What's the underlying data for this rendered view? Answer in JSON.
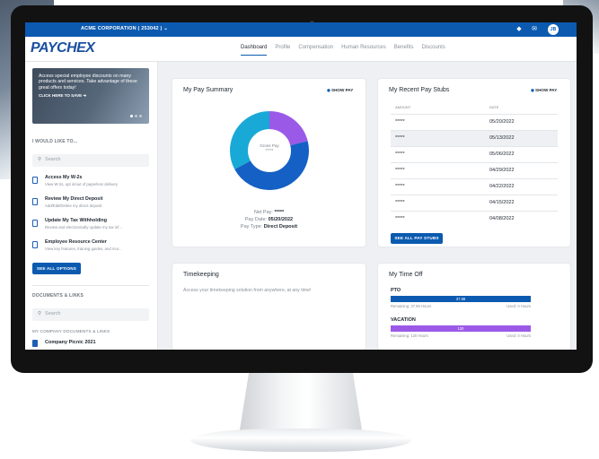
{
  "topbar": {
    "company": "ACME CORPORATION ( 253042 ) ⌄",
    "avatar_initials": "JB",
    "icons": [
      "pin-icon",
      "mail-icon"
    ]
  },
  "nav": {
    "logo": "PAYCHEX",
    "tabs": [
      {
        "label": "Dashboard",
        "active": true
      },
      {
        "label": "Profile"
      },
      {
        "label": "Compensation"
      },
      {
        "label": "Human Resources"
      },
      {
        "label": "Benefits"
      },
      {
        "label": "Discounts"
      }
    ]
  },
  "sidebar": {
    "banner": {
      "text": "Access special employee discounts on many products and services. Take advantage of these great offers today!",
      "cta": "CLICK HERE TO SAVE ➔"
    },
    "would_like_heading": "I WOULD LIKE TO...",
    "search_placeholder": "Search",
    "options": [
      {
        "title": "Access My W-2s",
        "sub": "View W-2s, opt in/out of paperless delivery"
      },
      {
        "title": "Review My Direct Deposit",
        "sub": "Add/Edit/Delete my direct deposit"
      },
      {
        "title": "Update My Tax Withholding",
        "sub": "Review and electronically update my tax inf..."
      },
      {
        "title": "Employee Resource Center",
        "sub": "View key features, training guides, and mor..."
      }
    ],
    "see_all_options": "SEE ALL OPTIONS",
    "docs_heading": "DOCUMENTS & LINKS",
    "docs_search_placeholder": "Search",
    "my_company_heading": "MY COMPANY DOCUMENTS & LINKS",
    "doc_item": "Company Picnic 2021"
  },
  "pay_summary": {
    "title": "My Pay Summary",
    "show_pay": "SHOW PAY",
    "center_label": "Gross Pay",
    "center_value": "*****",
    "net_pay_label": "Net Pay:",
    "net_pay_value": "*****",
    "pay_date_label": "Pay Date:",
    "pay_date_value": "05/20/2022",
    "pay_type_label": "Pay Type:",
    "pay_type_value": "Direct Deposit",
    "donut": [
      {
        "name": "segment-purple",
        "fraction": 0.21,
        "color": "#9b59e8"
      },
      {
        "name": "segment-blue",
        "fraction": 0.46,
        "color": "#1560c4"
      },
      {
        "name": "segment-teal",
        "fraction": 0.33,
        "color": "#18a9d6"
      }
    ]
  },
  "pay_stubs": {
    "title": "My Recent Pay Stubs",
    "show_pay": "SHOW PAY",
    "col_amount": "AMOUNT",
    "col_date": "DATE",
    "rows": [
      {
        "amount": "*****",
        "date": "05/20/2022"
      },
      {
        "amount": "*****",
        "date": "05/13/2022"
      },
      {
        "amount": "*****",
        "date": "05/06/2022"
      },
      {
        "amount": "*****",
        "date": "04/29/2022"
      },
      {
        "amount": "*****",
        "date": "04/22/2022"
      },
      {
        "amount": "*****",
        "date": "04/15/2022"
      },
      {
        "amount": "*****",
        "date": "04/08/2022"
      }
    ],
    "see_all": "SEE ALL PAY STUBS"
  },
  "timekeeping": {
    "title": "Timekeeping",
    "text": "Access your timekeeping solution from anywhere, at any time!"
  },
  "time_off": {
    "title": "My Time Off",
    "items": [
      {
        "label": "PTO",
        "bar_value": "37.89",
        "fraction": 1.0,
        "color": "#0b5ab0",
        "remaining": "Remaining: 37.89 Hours",
        "used": "Used: 0 Hours"
      },
      {
        "label": "VACATION",
        "bar_value": "120",
        "fraction": 1.0,
        "color": "#9b59e8",
        "remaining": "Remaining: 120 Hours",
        "used": "Used: 0 Hours"
      }
    ]
  }
}
